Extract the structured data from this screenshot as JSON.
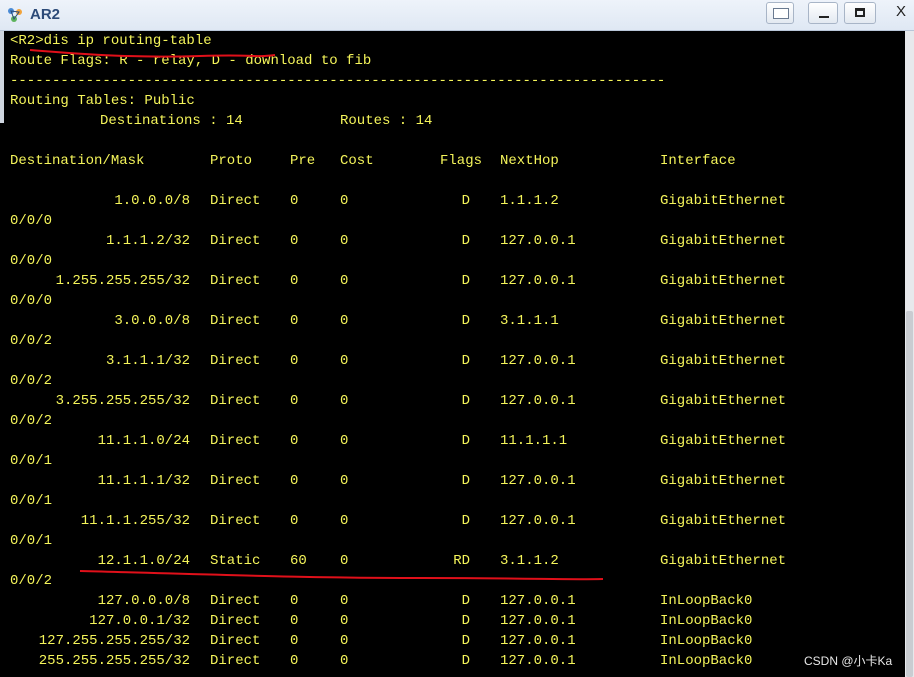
{
  "window": {
    "title": "AR2",
    "icons": {
      "app": "network-device-icon",
      "extra": "window-layout-icon",
      "minimize": "minimize-icon",
      "maximize": "maximize-icon",
      "close": "close-icon"
    },
    "close_label": "X"
  },
  "terminal": {
    "prompt_line": "<R2>dis ip routing-table",
    "flags_line": "Route Flags: R - relay, D - download to fib",
    "separator": "------------------------------------------------------------------------------",
    "tables_line": "Routing Tables: Public",
    "destinations_label": "Destinations : 14",
    "routes_label": "Routes : 14",
    "headers": {
      "dest": "Destination/Mask",
      "proto": "Proto",
      "pre": "Pre",
      "cost": "Cost",
      "flags": "Flags",
      "nexthop": "NextHop",
      "iface": "Interface"
    },
    "rows": [
      {
        "dest": "1.0.0.0/8",
        "proto": "Direct",
        "pre": "0",
        "cost": "0",
        "flags": "D",
        "nexthop": "1.1.1.2",
        "iface": "GigabitEthernet",
        "wrap": "0/0/0"
      },
      {
        "dest": "1.1.1.2/32",
        "proto": "Direct",
        "pre": "0",
        "cost": "0",
        "flags": "D",
        "nexthop": "127.0.0.1",
        "iface": "GigabitEthernet",
        "wrap": "0/0/0"
      },
      {
        "dest": "1.255.255.255/32",
        "proto": "Direct",
        "pre": "0",
        "cost": "0",
        "flags": "D",
        "nexthop": "127.0.0.1",
        "iface": "GigabitEthernet",
        "wrap": "0/0/0"
      },
      {
        "dest": "3.0.0.0/8",
        "proto": "Direct",
        "pre": "0",
        "cost": "0",
        "flags": "D",
        "nexthop": "3.1.1.1",
        "iface": "GigabitEthernet",
        "wrap": "0/0/2"
      },
      {
        "dest": "3.1.1.1/32",
        "proto": "Direct",
        "pre": "0",
        "cost": "0",
        "flags": "D",
        "nexthop": "127.0.0.1",
        "iface": "GigabitEthernet",
        "wrap": "0/0/2"
      },
      {
        "dest": "3.255.255.255/32",
        "proto": "Direct",
        "pre": "0",
        "cost": "0",
        "flags": "D",
        "nexthop": "127.0.0.1",
        "iface": "GigabitEthernet",
        "wrap": "0/0/2"
      },
      {
        "dest": "11.1.1.0/24",
        "proto": "Direct",
        "pre": "0",
        "cost": "0",
        "flags": "D",
        "nexthop": "11.1.1.1",
        "iface": "GigabitEthernet",
        "wrap": "0/0/1"
      },
      {
        "dest": "11.1.1.1/32",
        "proto": "Direct",
        "pre": "0",
        "cost": "0",
        "flags": "D",
        "nexthop": "127.0.0.1",
        "iface": "GigabitEthernet",
        "wrap": "0/0/1"
      },
      {
        "dest": "11.1.1.255/32",
        "proto": "Direct",
        "pre": "0",
        "cost": "0",
        "flags": "D",
        "nexthop": "127.0.0.1",
        "iface": "GigabitEthernet",
        "wrap": "0/0/1"
      },
      {
        "dest": "12.1.1.0/24",
        "proto": "Static",
        "pre": "60",
        "cost": "0",
        "flags": "RD",
        "nexthop": "3.1.1.2",
        "iface": "GigabitEthernet",
        "wrap": "0/0/2"
      },
      {
        "dest": "127.0.0.0/8",
        "proto": "Direct",
        "pre": "0",
        "cost": "0",
        "flags": "D",
        "nexthop": "127.0.0.1",
        "iface": "InLoopBack0",
        "wrap": ""
      },
      {
        "dest": "127.0.0.1/32",
        "proto": "Direct",
        "pre": "0",
        "cost": "0",
        "flags": "D",
        "nexthop": "127.0.0.1",
        "iface": "InLoopBack0",
        "wrap": ""
      },
      {
        "dest": "127.255.255.255/32",
        "proto": "Direct",
        "pre": "0",
        "cost": "0",
        "flags": "D",
        "nexthop": "127.0.0.1",
        "iface": "InLoopBack0",
        "wrap": ""
      },
      {
        "dest": "255.255.255.255/32",
        "proto": "Direct",
        "pre": "0",
        "cost": "0",
        "flags": "D",
        "nexthop": "127.0.0.1",
        "iface": "InLoopBack0",
        "wrap": ""
      }
    ]
  },
  "watermark": "CSDN @小卡Ka",
  "colors": {
    "terminal_bg": "#000000",
    "terminal_text": "#f5f55a",
    "annotation": "#e0101a"
  }
}
